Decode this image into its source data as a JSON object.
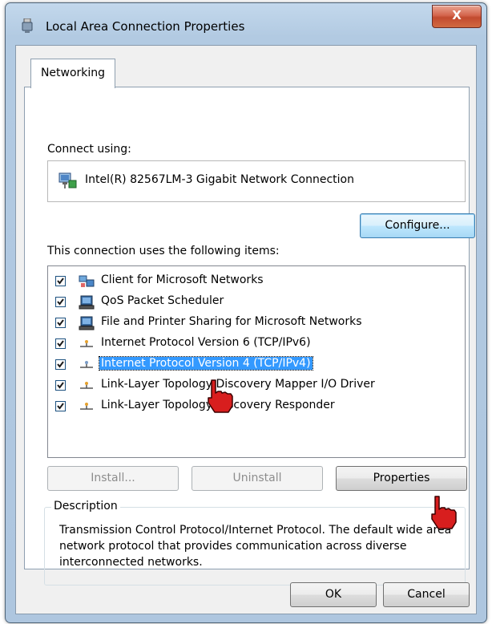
{
  "window": {
    "title": "Local Area Connection Properties",
    "close_label": "X"
  },
  "tabs": [
    {
      "label": "Networking",
      "selected": true
    }
  ],
  "connect_using": {
    "label": "Connect using:",
    "adapter": "Intel(R) 82567LM-3 Gigabit Network Connection",
    "configure_label": "Configure..."
  },
  "items_section": {
    "label": "This connection uses the following items:",
    "items": [
      {
        "label": "Client for Microsoft Networks",
        "checked": true,
        "icon": "network-client-icon"
      },
      {
        "label": "QoS Packet Scheduler",
        "checked": true,
        "icon": "computer-icon"
      },
      {
        "label": "File and Printer Sharing for Microsoft Networks",
        "checked": true,
        "icon": "computer-icon"
      },
      {
        "label": "Internet Protocol Version 6 (TCP/IPv6)",
        "checked": true,
        "icon": "protocol-icon"
      },
      {
        "label": "Internet Protocol Version 4 (TCP/IPv4)",
        "checked": true,
        "icon": "protocol-icon",
        "selected": true
      },
      {
        "label": "Link-Layer Topology Discovery Mapper I/O Driver",
        "checked": true,
        "icon": "protocol-icon"
      },
      {
        "label": "Link-Layer Topology Discovery Responder",
        "checked": true,
        "icon": "protocol-icon"
      }
    ]
  },
  "buttons": {
    "install": "Install...",
    "uninstall": "Uninstall",
    "properties": "Properties",
    "ok": "OK",
    "cancel": "Cancel"
  },
  "description": {
    "legend": "Description",
    "text": "Transmission Control Protocol/Internet Protocol. The default wide area network protocol that provides communication across diverse interconnected networks."
  },
  "colors": {
    "selection": "#3399ff",
    "close_button": "#c94a2f",
    "frame": "#b2cae2"
  }
}
